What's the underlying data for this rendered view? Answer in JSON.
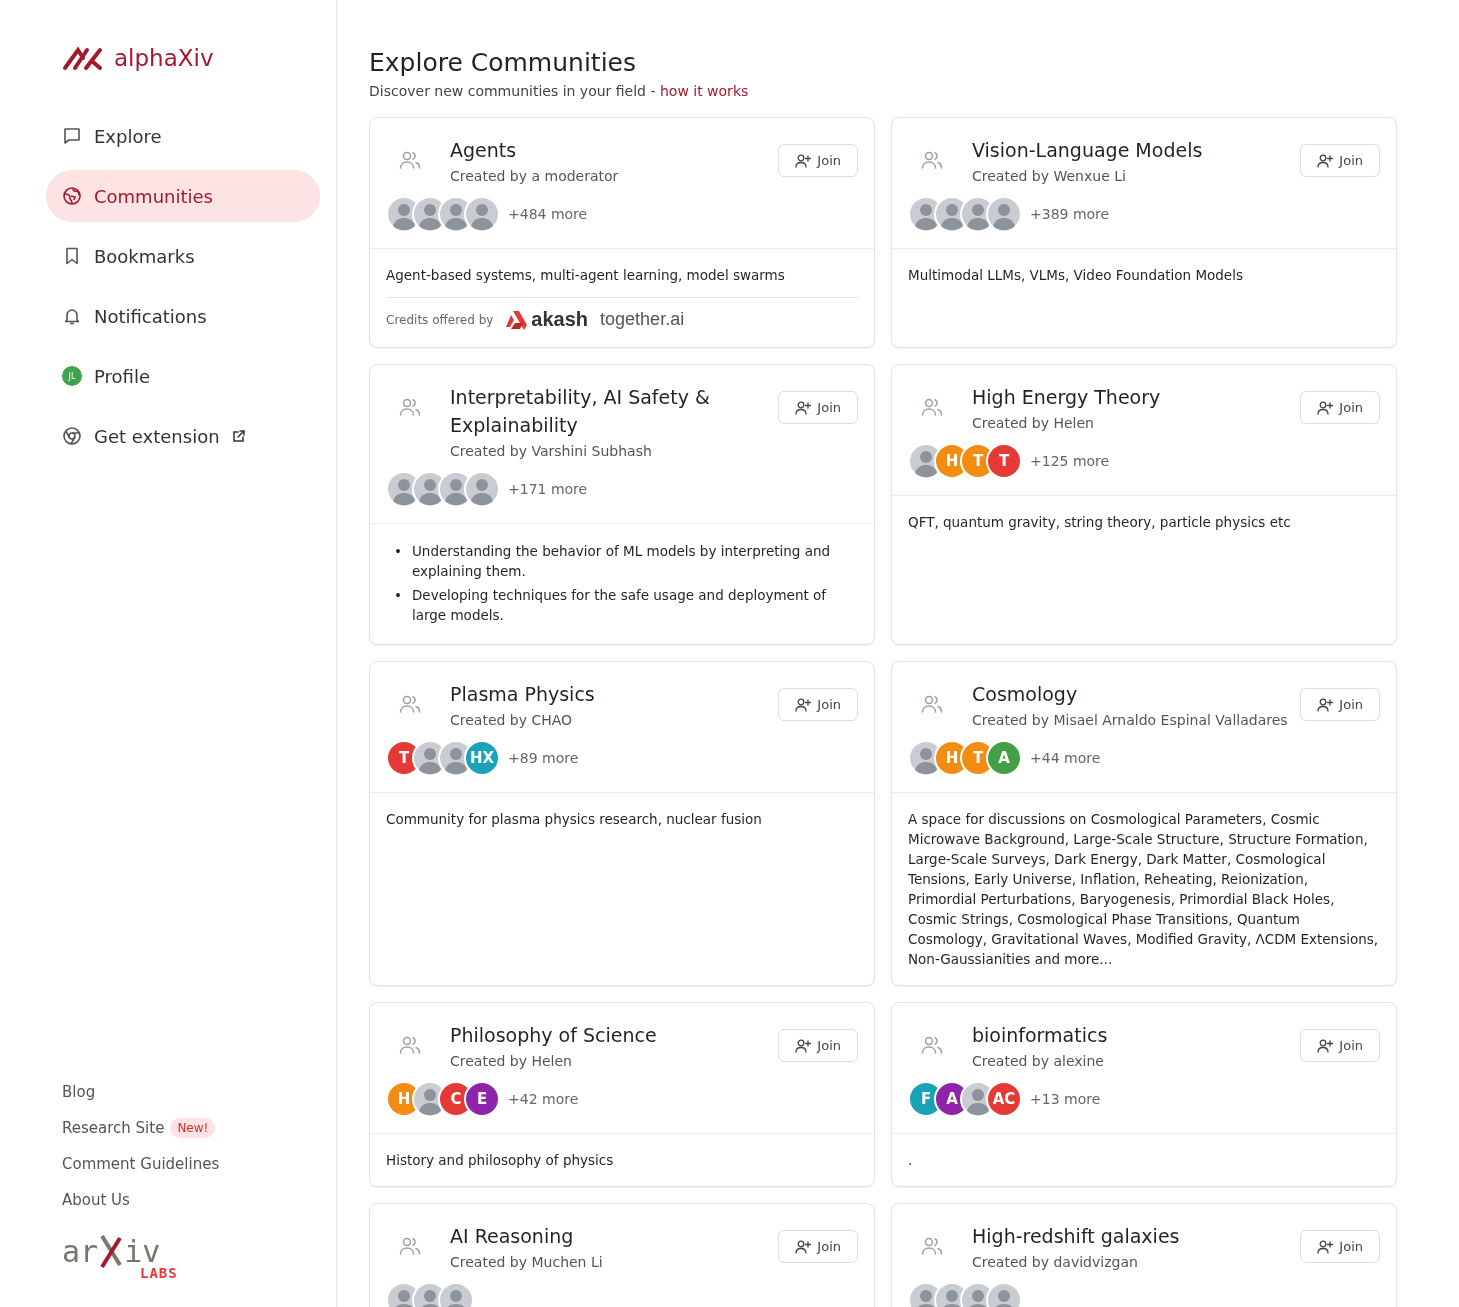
{
  "sidebar": {
    "logo": {
      "name": "alphaXiv"
    },
    "nav": [
      {
        "label": "Explore",
        "selected": false
      },
      {
        "label": "Communities",
        "selected": true
      },
      {
        "label": "Bookmarks",
        "selected": false
      },
      {
        "label": "Notifications",
        "selected": false
      },
      {
        "label": "Profile",
        "avatar_text": "JL",
        "selected": false
      },
      {
        "label": "Get extension",
        "external": true,
        "selected": false
      }
    ],
    "footer_links": [
      {
        "label": "Blog"
      },
      {
        "label": "Research Site",
        "badge": "New!"
      },
      {
        "label": "Comment Guidelines"
      },
      {
        "label": "About Us"
      }
    ],
    "labs_logo": {
      "left": "ar",
      "right": "iv",
      "sub": "LABS"
    }
  },
  "page": {
    "title": "Explore Communities",
    "subtitle": "Discover new communities in your field - ",
    "link": "how it works"
  },
  "communities": [
    {
      "title": "Agents",
      "creator": "Created by a moderator",
      "join": "Join",
      "more": "+484 more",
      "avatars": [
        {
          "kind": "photo"
        },
        {
          "kind": "photo"
        },
        {
          "kind": "photo"
        },
        {
          "kind": "photo"
        }
      ],
      "description": "Agent-based systems, multi-agent learning, model swarms",
      "credits": {
        "label": "Credits offered by",
        "sponsors": [
          "akash",
          "together.ai"
        ]
      }
    },
    {
      "title": "Vision-Language Models",
      "creator": "Created by Wenxue Li",
      "join": "Join",
      "more": "+389 more",
      "avatars": [
        {
          "kind": "photo"
        },
        {
          "kind": "photo"
        },
        {
          "kind": "photo"
        },
        {
          "kind": "photo"
        }
      ],
      "description": "Multimodal LLMs, VLMs, Video Foundation Models"
    },
    {
      "title": "Interpretability, AI Safety & Explainability",
      "creator": "Created by Varshini Subhash",
      "join": "Join",
      "more": "+171 more",
      "avatars": [
        {
          "kind": "photo"
        },
        {
          "kind": "photo"
        },
        {
          "kind": "photo"
        },
        {
          "kind": "photo"
        }
      ],
      "bullets": [
        {
          "marker": "•",
          "text": "Understanding the behavior of ML models by interpreting and explaining them."
        },
        {
          "marker": "•",
          "text": "Developing techniques for the safe usage and deployment of large models."
        }
      ]
    },
    {
      "title": "High Energy Theory",
      "creator": "Created by Helen",
      "join": "Join",
      "more": "+125 more",
      "avatars": [
        {
          "kind": "photo"
        },
        {
          "kind": "letter",
          "text": "H",
          "color": "#f28c13"
        },
        {
          "kind": "letter",
          "text": "T",
          "color": "#f28c13"
        },
        {
          "kind": "letter",
          "text": "T",
          "color": "#e53935"
        }
      ],
      "description": "QFT, quantum gravity, string theory, particle physics etc"
    },
    {
      "title": "Plasma Physics",
      "creator": "Created by CHAO",
      "join": "Join",
      "more": "+89 more",
      "avatars": [
        {
          "kind": "letter",
          "text": "T",
          "color": "#e53935"
        },
        {
          "kind": "photo"
        },
        {
          "kind": "photo"
        },
        {
          "kind": "letter",
          "text": "HX",
          "color": "#1aa3b8"
        }
      ],
      "description": "Community for plasma physics research, nuclear fusion"
    },
    {
      "title": "Cosmology",
      "creator": "Created by Misael Arnaldo Espinal Valladares",
      "join": "Join",
      "more": "+44 more",
      "avatars": [
        {
          "kind": "photo"
        },
        {
          "kind": "letter",
          "text": "H",
          "color": "#f28c13"
        },
        {
          "kind": "letter",
          "text": "T",
          "color": "#f28c13"
        },
        {
          "kind": "letter",
          "text": "A",
          "color": "#43a047"
        }
      ],
      "description": "A space for discussions on Cosmological Parameters, Cosmic Microwave Background, Large-Scale Structure, Structure Formation, Large-Scale Surveys, Dark Energy, Dark Matter, Cosmological Tensions, Early Universe, Inflation, Reheating, Reionization, Primordial Perturbations, Baryogenesis, Primordial Black Holes, Cosmic Strings, Cosmological Phase Transitions, Quantum Cosmology, Gravitational Waves, Modified Gravity, ΛCDM Extensions, Non-Gaussianities and more..."
    },
    {
      "title": "Philosophy of Science",
      "creator": "Created by Helen",
      "join": "Join",
      "more": "+42 more",
      "avatars": [
        {
          "kind": "letter",
          "text": "H",
          "color": "#f28c13"
        },
        {
          "kind": "photo"
        },
        {
          "kind": "letter",
          "text": "C",
          "color": "#e53935"
        },
        {
          "kind": "letter",
          "text": "E",
          "color": "#8e24aa"
        }
      ],
      "description": "History and philosophy of physics"
    },
    {
      "title": "bioinformatics",
      "creator": "Created by alexine",
      "join": "Join",
      "more": "+13 more",
      "avatars": [
        {
          "kind": "letter",
          "text": "F",
          "color": "#1aa3b8"
        },
        {
          "kind": "letter",
          "text": "A",
          "color": "#8e24aa"
        },
        {
          "kind": "photo"
        },
        {
          "kind": "letter",
          "text": "AC",
          "color": "#e53935"
        }
      ],
      "description": "."
    },
    {
      "title": "AI Reasoning",
      "creator": "Created by Muchen Li",
      "join": "Join",
      "avatars": [
        {
          "kind": "photo"
        },
        {
          "kind": "photo"
        },
        {
          "kind": "photo"
        }
      ]
    },
    {
      "title": "High-redshift galaxies",
      "creator": "Created by davidvizgan",
      "join": "Join",
      "avatars": [
        {
          "kind": "photo"
        },
        {
          "kind": "photo"
        },
        {
          "kind": "photo"
        },
        {
          "kind": "photo"
        }
      ]
    }
  ]
}
